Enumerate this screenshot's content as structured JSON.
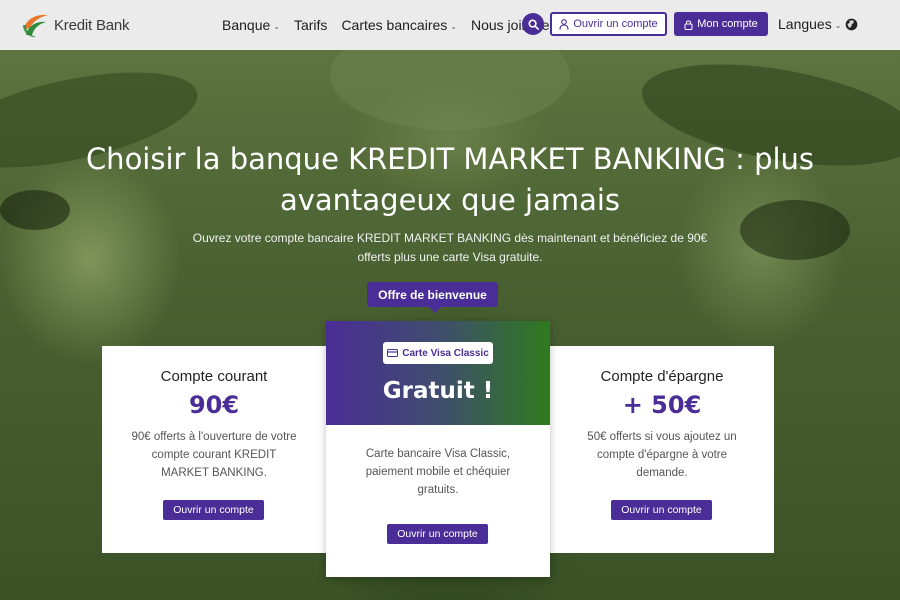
{
  "brand": {
    "name": "Kredit Bank"
  },
  "nav": {
    "items": [
      {
        "label": "Banque",
        "dropdown": true
      },
      {
        "label": "Tarifs",
        "dropdown": false
      },
      {
        "label": "Cartes bancaires",
        "dropdown": true
      },
      {
        "label": "Nous joindre",
        "dropdown": false
      }
    ],
    "open_account": "Ouvrir un compte",
    "my_account": "Mon compte",
    "languages": "Langues"
  },
  "hero": {
    "title": "Choisir la banque KREDIT MARKET BANKING : plus avantageux que jamais",
    "subtitle": "Ouvrez votre compte bancaire KREDIT MARKET BANKING dès maintenant et bénéficiez de 90€ offerts plus une carte Visa gratuite.",
    "welcome": "Offre de bienvenue"
  },
  "cards": {
    "left": {
      "title": "Compte courant",
      "amount": "90€",
      "desc": "90€ offerts à l'ouverture de votre compte courant KREDIT MARKET BANKING.",
      "button": "Ouvrir un compte"
    },
    "middle": {
      "badge": "Carte Visa Classic",
      "headline": "Gratuit !",
      "desc": "Carte bancaire Visa Classic, paiement mobile et chéquier gratuits.",
      "button": "Ouvrir un compte"
    },
    "right": {
      "title": "Compte d'épargne",
      "amount": "+ 50€",
      "desc": "50€ offerts si vous ajoutez un compte d'épargne à votre demande.",
      "button": "Ouvrir un compte"
    }
  },
  "colors": {
    "accent": "#4a2d96",
    "green": "#2f7a1e",
    "nav_bg": "#ebebeb"
  },
  "icons": [
    "logo-icon",
    "search-icon",
    "user-icon",
    "lock-icon",
    "globe-icon",
    "credit-card-icon",
    "chevron-down-icon"
  ]
}
